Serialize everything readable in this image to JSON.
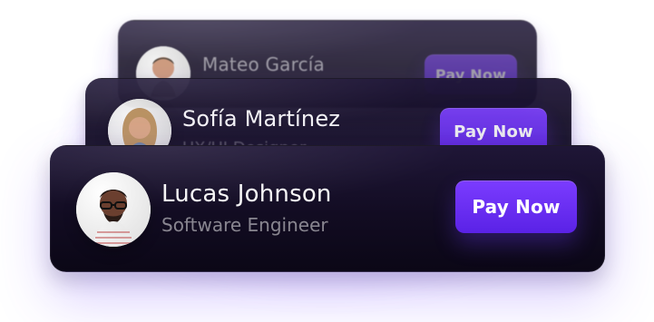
{
  "theme": {
    "accent": "#6a2cff",
    "accent_dark": "#5a22e6",
    "card_bg": "#120c22"
  },
  "cards": [
    {
      "name": "Mateo García",
      "role": "",
      "button_label": "Pay Now",
      "avatar_icon": "person-avatar-icon"
    },
    {
      "name": "Sofía Martínez",
      "role": "UX/UI Designer",
      "button_label": "Pay Now",
      "avatar_icon": "person-avatar-icon"
    },
    {
      "name": "Lucas Johnson",
      "role": "Software Engineer",
      "button_label": "Pay Now",
      "avatar_icon": "person-avatar-icon"
    }
  ]
}
